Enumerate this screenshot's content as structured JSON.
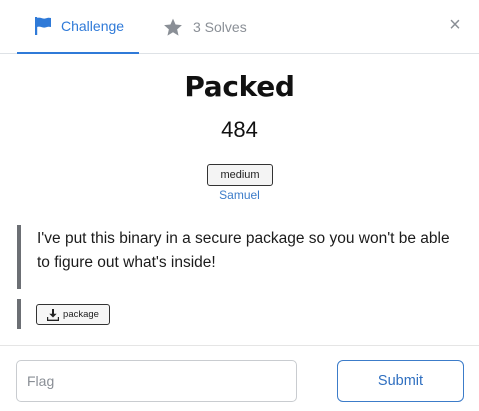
{
  "tabs": [
    {
      "label": "Challenge",
      "icon": "flag-icon",
      "active": true
    },
    {
      "label": "3 Solves",
      "icon": "star-icon",
      "active": false
    }
  ],
  "close_icon": "×",
  "challenge": {
    "name": "Packed",
    "points": "484",
    "tag": "medium",
    "author": "Samuel",
    "description": "I've put this binary in a secure package so you won't be able to figure out what's inside!",
    "file": {
      "label": "package",
      "icon": "download-icon"
    }
  },
  "form": {
    "flag_placeholder": "Flag",
    "flag_value": "",
    "submit_label": "Submit"
  },
  "colors": {
    "accent": "#2f7ad8",
    "muted": "#8a8f96",
    "link": "#3c7cc9",
    "quote_border": "#6c6f74"
  }
}
